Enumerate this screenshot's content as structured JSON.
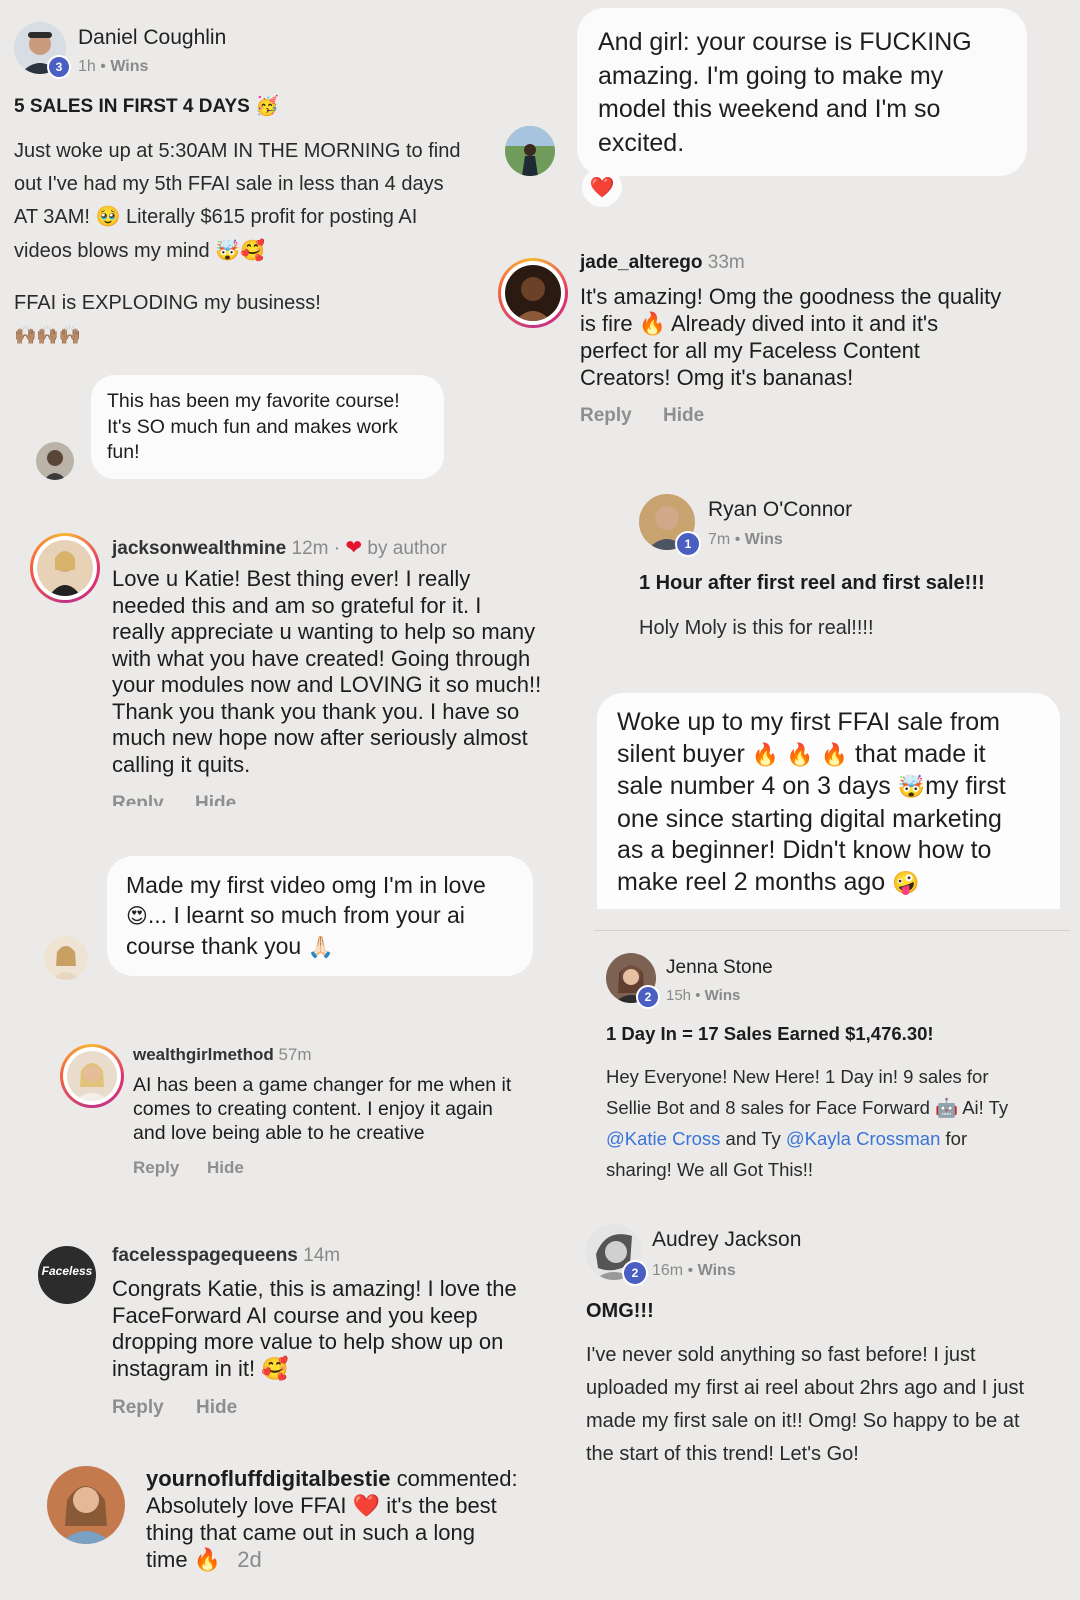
{
  "post_daniel": {
    "name": "Daniel Coughlin",
    "badge": "3",
    "time": "1h",
    "sep": "•",
    "group": "Wins",
    "title": "5 SALES IN FIRST 4 DAYS",
    "title_emoji": "🥳",
    "body_1a": "Just woke up at 5:30AM IN THE MORNING to find",
    "body_1b": "out I've had my 5th FFAI sale in less than 4 days",
    "body_1c": "AT 3AM!",
    "body_1c_emoji": "🥹",
    "body_1c_rest": "Literally $615 profit for posting AI",
    "body_1d": "videos blows my mind",
    "body_1d_emoji": "🤯🥰",
    "body_2": "FFAI is EXPLODING my business!",
    "body_2_emoji": "🙌🏽🙌🏽🙌🏽"
  },
  "msg_course": {
    "text_1": "And girl: your course is FUCKING",
    "text_2": "amazing. I'm going to make my",
    "text_3": "model this weekend and I'm so",
    "text_4": "excited.",
    "reaction": "❤️"
  },
  "comment_jade": {
    "username": "jade_alterego",
    "time": "33m",
    "line_1": "It's amazing! Omg the goodness the quality",
    "line_2a": "is fire",
    "line_2_emoji": "🔥",
    "line_2b": "Already dived into it and it's",
    "line_3": "perfect for all my Faceless Content",
    "line_4": "Creators! Omg it's bananas!",
    "reply": "Reply",
    "hide": "Hide"
  },
  "msg_favorite": {
    "line_1": "This has been my favorite course!",
    "line_2": "It's SO much fun and makes work",
    "line_3": "fun!"
  },
  "post_ryan": {
    "name": "Ryan O'Connor",
    "badge": "1",
    "time": "7m",
    "sep": "•",
    "group": "Wins",
    "title": "1 Hour after first reel and first sale!!!",
    "body": "Holy Moly is this for real!!!!"
  },
  "comment_jackson": {
    "username": "jacksonwealthmine",
    "time": "12m",
    "sep": "·",
    "heart": "❤",
    "by_author": "by author",
    "lines": [
      "Love u Katie! Best thing ever! I really",
      "needed this and am so grateful for it. I",
      "really appreciate u wanting to help so many",
      "with what you have created! Going through",
      "your modules now and LOVING it so much!!",
      "Thank you thank you thank you. I have so",
      "much new hope now after seriously almost",
      "calling it quits."
    ],
    "reply": "Reply",
    "hide": "Hide"
  },
  "msg_silent_buyer": {
    "line_1": "Woke up to my first FFAI sale from",
    "line_2a": "silent buyer",
    "line_2_emoji": "🔥 🔥 🔥",
    "line_2b": "that made it",
    "line_3a": "sale number 4 on 3 days",
    "line_3_emoji": "🤯",
    "line_3b": "my first",
    "line_4": "one since starting digital marketing",
    "line_5": "as a beginner! Didn't know how to",
    "line_6a": "make reel 2 months ago",
    "line_6_emoji": "🤪"
  },
  "msg_first_video": {
    "line_1": "Made my first video omg I'm in love",
    "line_2_emoji": "😍",
    "line_2": "... I learnt so much from your ai",
    "line_3": "course thank you",
    "line_3_emoji": "🙏🏻"
  },
  "post_jenna": {
    "name": "Jenna Stone",
    "badge": "2",
    "time": "15h",
    "sep": "•",
    "group": "Wins",
    "title": "1 Day In = 17 Sales Earned $1,476.30!",
    "line_1": "Hey Everyone! New Here! 1 Day in! 9 sales for",
    "line_2a": "Sellie Bot and 8 sales for Face Forward",
    "line_2_emoji": "🤖",
    "line_2b": "Ai! Ty",
    "mention_1": "@Katie Cross",
    "and_ty": "and Ty",
    "mention_2": "@Kayla Crossman",
    "for_text": "for",
    "line_4": "sharing! We all Got This!!"
  },
  "comment_wealthgirl": {
    "username": "wealthgirlmethod",
    "time": "57m",
    "line_1": "AI has been a game changer for me when it",
    "line_2": "comes to creating content. I enjoy it again",
    "line_3": "and love being able to he creative",
    "reply": "Reply",
    "hide": "Hide"
  },
  "comment_faceless": {
    "username": "facelesspagequeens",
    "time": "14m",
    "avatar_text": "Faceless",
    "line_1": "Congrats Katie, this is amazing! I love the",
    "line_2": "FaceForward AI course and you keep",
    "line_3": "dropping more value to help show up on",
    "line_4": "instagram in it!",
    "line_4_emoji": "🥰",
    "reply": "Reply",
    "hide": "Hide"
  },
  "post_audrey": {
    "name": "Audrey Jackson",
    "badge": "2",
    "time": "16m",
    "sep": "•",
    "group": "Wins",
    "title": "OMG!!!",
    "lines": [
      "I've never sold anything so fast before! I just",
      "uploaded my first ai reel about 2hrs ago and I just",
      "made my first sale on it!! Omg! So happy to be at",
      "the start of this trend! Let's Go!"
    ]
  },
  "comment_bestie": {
    "username": "yournofluffdigitalbestie",
    "commented": "commented:",
    "line_2a": "Absolutely love FFAI",
    "line_2_emoji": "❤️",
    "line_2b": "it's the best",
    "line_3": "thing that came out in such a long",
    "line_4a": "time",
    "line_4_emoji": "🔥",
    "time": "2d"
  }
}
